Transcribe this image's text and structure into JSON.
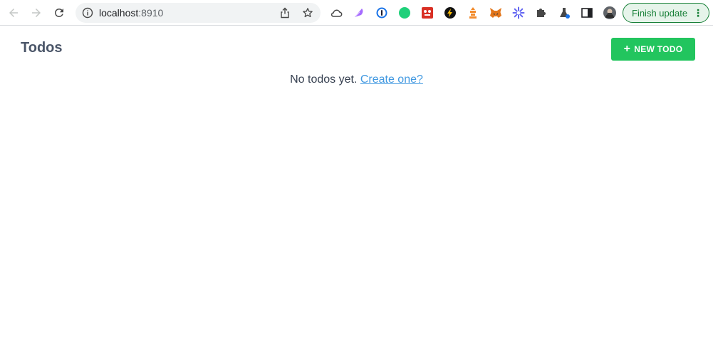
{
  "browser": {
    "url_host": "localhost",
    "url_port": ":8910",
    "finish_update_label": "Finish update",
    "menu_glyph": "⋮",
    "extensions": [
      "cloud-icon",
      "feather-extension-icon",
      "1password-icon",
      "green-dot-extension-icon",
      "red-extension-icon",
      "bolt-extension-icon",
      "orange-extension-icon",
      "metamask-icon",
      "asterisk-extension-icon",
      "puzzle-icon",
      "flask-icon",
      "sidebar-icon",
      "avatar"
    ]
  },
  "app": {
    "title": "Todos",
    "new_todo_label": "NEW TODO",
    "plus_glyph": "+",
    "empty_text": "No todos yet.",
    "create_link": "Create one?"
  },
  "colors": {
    "primary_button": "#22c55e",
    "link": "#4299e1",
    "title": "#4a5568"
  }
}
